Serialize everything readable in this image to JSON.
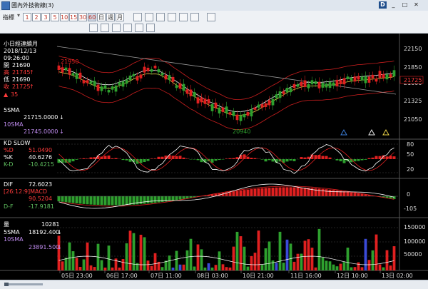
{
  "window": {
    "title": "國內外技術線(3)",
    "controls": [
      "_",
      "□",
      "✕"
    ],
    "badge": "D"
  },
  "toolbar": {
    "mode_label": "指標",
    "periods": [
      "1",
      "2",
      "3",
      "5",
      "10",
      "15",
      "30",
      "60",
      "日",
      "週",
      "月"
    ],
    "selected_period": "60"
  },
  "chart": {
    "product": "小日經連續月",
    "date": "2018/12/13",
    "time": "09:26:00",
    "open_label": "開",
    "open": "21690",
    "high_label": "高",
    "high": "21745",
    "low_label": "低",
    "low": "21690",
    "close_label": "收",
    "close": "21725",
    "change": "35",
    "sma5_label": "5SMA",
    "sma5": "21715.0000",
    "sma10_label": "10SMA",
    "sma10": "21745.0000",
    "marker_high": "21950",
    "marker_low": "20940",
    "last_price_tag": "21725",
    "price_axis": [
      "22150",
      "21850",
      "21600",
      "21325",
      "21050"
    ],
    "kd_title": "KD SLOW",
    "pctd_label": "%D",
    "pctd": "51.0490",
    "pctk_label": "%K",
    "pctk": "40.6276",
    "kmd_label": "K-D",
    "kmd": "-10.4215",
    "kd_axis": [
      "80",
      "50",
      "20"
    ],
    "dif_label": "DIF",
    "dif": "72.6023",
    "macd_label": "[26:12:9]MACD",
    "macd": "90.5204",
    "df_label": "D-F",
    "df": "-17.9181",
    "macd_axis": [
      "0",
      "-105"
    ],
    "vol_label": "量",
    "vol": "10281",
    "vsma5_label": "5SMA",
    "vsma5": "18192.400",
    "vsma10_label": "10SMA",
    "vsma10": "23891.500",
    "vol_axis": [
      "150000",
      "100000",
      "50000"
    ],
    "x_labels": [
      "05日 23:00",
      "06日 17:00",
      "07日 11:00",
      "08日 03:00",
      "10日 21:00",
      "11日 16:00",
      "12日 10:00",
      "13日 02:00"
    ]
  },
  "colors": {
    "up": "#e02020",
    "down": "#2ea02e",
    "bg": "#000000",
    "ma_white": "#ffffff",
    "ma_yellow": "#e8d048",
    "ma_grey": "#9a9a9a",
    "band": "#c81e1e"
  }
}
